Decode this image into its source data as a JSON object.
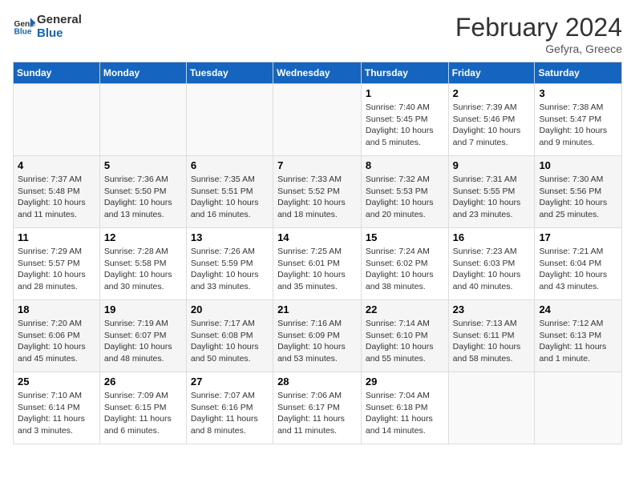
{
  "logo": {
    "line1": "General",
    "line2": "Blue"
  },
  "title": "February 2024",
  "subtitle": "Gefyra, Greece",
  "weekdays": [
    "Sunday",
    "Monday",
    "Tuesday",
    "Wednesday",
    "Thursday",
    "Friday",
    "Saturday"
  ],
  "weeks": [
    [
      {
        "day": "",
        "info": ""
      },
      {
        "day": "",
        "info": ""
      },
      {
        "day": "",
        "info": ""
      },
      {
        "day": "",
        "info": ""
      },
      {
        "day": "1",
        "info": "Sunrise: 7:40 AM\nSunset: 5:45 PM\nDaylight: 10 hours\nand 5 minutes."
      },
      {
        "day": "2",
        "info": "Sunrise: 7:39 AM\nSunset: 5:46 PM\nDaylight: 10 hours\nand 7 minutes."
      },
      {
        "day": "3",
        "info": "Sunrise: 7:38 AM\nSunset: 5:47 PM\nDaylight: 10 hours\nand 9 minutes."
      }
    ],
    [
      {
        "day": "4",
        "info": "Sunrise: 7:37 AM\nSunset: 5:48 PM\nDaylight: 10 hours\nand 11 minutes."
      },
      {
        "day": "5",
        "info": "Sunrise: 7:36 AM\nSunset: 5:50 PM\nDaylight: 10 hours\nand 13 minutes."
      },
      {
        "day": "6",
        "info": "Sunrise: 7:35 AM\nSunset: 5:51 PM\nDaylight: 10 hours\nand 16 minutes."
      },
      {
        "day": "7",
        "info": "Sunrise: 7:33 AM\nSunset: 5:52 PM\nDaylight: 10 hours\nand 18 minutes."
      },
      {
        "day": "8",
        "info": "Sunrise: 7:32 AM\nSunset: 5:53 PM\nDaylight: 10 hours\nand 20 minutes."
      },
      {
        "day": "9",
        "info": "Sunrise: 7:31 AM\nSunset: 5:55 PM\nDaylight: 10 hours\nand 23 minutes."
      },
      {
        "day": "10",
        "info": "Sunrise: 7:30 AM\nSunset: 5:56 PM\nDaylight: 10 hours\nand 25 minutes."
      }
    ],
    [
      {
        "day": "11",
        "info": "Sunrise: 7:29 AM\nSunset: 5:57 PM\nDaylight: 10 hours\nand 28 minutes."
      },
      {
        "day": "12",
        "info": "Sunrise: 7:28 AM\nSunset: 5:58 PM\nDaylight: 10 hours\nand 30 minutes."
      },
      {
        "day": "13",
        "info": "Sunrise: 7:26 AM\nSunset: 5:59 PM\nDaylight: 10 hours\nand 33 minutes."
      },
      {
        "day": "14",
        "info": "Sunrise: 7:25 AM\nSunset: 6:01 PM\nDaylight: 10 hours\nand 35 minutes."
      },
      {
        "day": "15",
        "info": "Sunrise: 7:24 AM\nSunset: 6:02 PM\nDaylight: 10 hours\nand 38 minutes."
      },
      {
        "day": "16",
        "info": "Sunrise: 7:23 AM\nSunset: 6:03 PM\nDaylight: 10 hours\nand 40 minutes."
      },
      {
        "day": "17",
        "info": "Sunrise: 7:21 AM\nSunset: 6:04 PM\nDaylight: 10 hours\nand 43 minutes."
      }
    ],
    [
      {
        "day": "18",
        "info": "Sunrise: 7:20 AM\nSunset: 6:06 PM\nDaylight: 10 hours\nand 45 minutes."
      },
      {
        "day": "19",
        "info": "Sunrise: 7:19 AM\nSunset: 6:07 PM\nDaylight: 10 hours\nand 48 minutes."
      },
      {
        "day": "20",
        "info": "Sunrise: 7:17 AM\nSunset: 6:08 PM\nDaylight: 10 hours\nand 50 minutes."
      },
      {
        "day": "21",
        "info": "Sunrise: 7:16 AM\nSunset: 6:09 PM\nDaylight: 10 hours\nand 53 minutes."
      },
      {
        "day": "22",
        "info": "Sunrise: 7:14 AM\nSunset: 6:10 PM\nDaylight: 10 hours\nand 55 minutes."
      },
      {
        "day": "23",
        "info": "Sunrise: 7:13 AM\nSunset: 6:11 PM\nDaylight: 10 hours\nand 58 minutes."
      },
      {
        "day": "24",
        "info": "Sunrise: 7:12 AM\nSunset: 6:13 PM\nDaylight: 11 hours\nand 1 minute."
      }
    ],
    [
      {
        "day": "25",
        "info": "Sunrise: 7:10 AM\nSunset: 6:14 PM\nDaylight: 11 hours\nand 3 minutes."
      },
      {
        "day": "26",
        "info": "Sunrise: 7:09 AM\nSunset: 6:15 PM\nDaylight: 11 hours\nand 6 minutes."
      },
      {
        "day": "27",
        "info": "Sunrise: 7:07 AM\nSunset: 6:16 PM\nDaylight: 11 hours\nand 8 minutes."
      },
      {
        "day": "28",
        "info": "Sunrise: 7:06 AM\nSunset: 6:17 PM\nDaylight: 11 hours\nand 11 minutes."
      },
      {
        "day": "29",
        "info": "Sunrise: 7:04 AM\nSunset: 6:18 PM\nDaylight: 11 hours\nand 14 minutes."
      },
      {
        "day": "",
        "info": ""
      },
      {
        "day": "",
        "info": ""
      }
    ]
  ]
}
